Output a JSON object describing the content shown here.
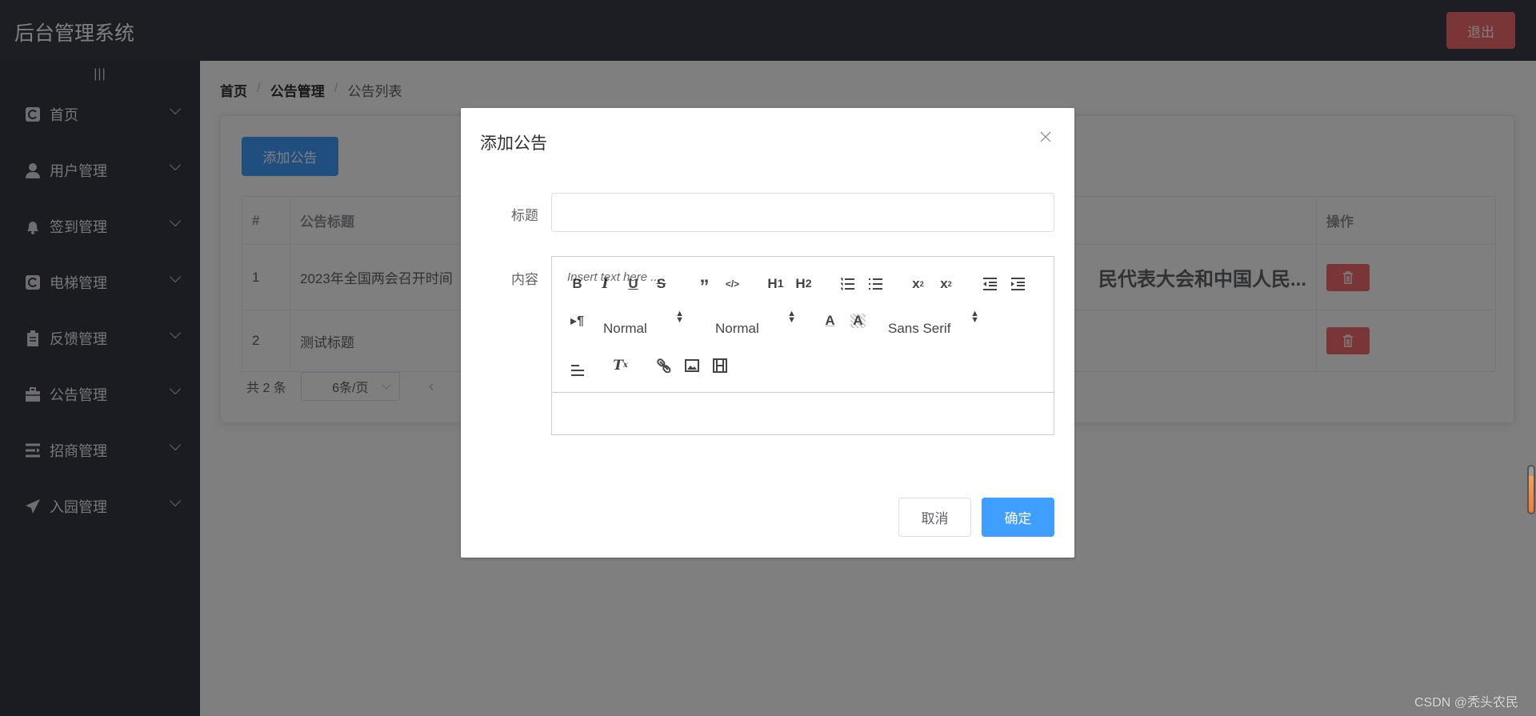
{
  "header": {
    "title": "后台管理系统",
    "logout_label": "退出"
  },
  "sidebar": {
    "toggle": "|||",
    "items": [
      {
        "label": "首页",
        "icon": "eleme-icon"
      },
      {
        "label": "用户管理",
        "icon": "user-icon"
      },
      {
        "label": "签到管理",
        "icon": "bell-icon"
      },
      {
        "label": "电梯管理",
        "icon": "eleme-icon"
      },
      {
        "label": "反馈管理",
        "icon": "clipboard-icon"
      },
      {
        "label": "公告管理",
        "icon": "briefcase-icon"
      },
      {
        "label": "招商管理",
        "icon": "menu-unfold-icon"
      },
      {
        "label": "入园管理",
        "icon": "paper-plane-icon"
      }
    ]
  },
  "breadcrumb": [
    "首页",
    "公告管理",
    "公告列表"
  ],
  "main": {
    "add_label": "添加公告",
    "table": {
      "headers": [
        "#",
        "公告标题",
        "操作"
      ],
      "rows": [
        {
          "index": "1",
          "title": "2023年全国两会召开时间",
          "content": "民代表大会和中国人民..."
        },
        {
          "index": "2",
          "title": "测试标题",
          "content": ""
        }
      ]
    },
    "pagination": {
      "total": "共 2 条",
      "page_size": "6条/页"
    }
  },
  "modal": {
    "title": "添加公告",
    "title_label": "标题",
    "title_value": "",
    "content_label": "内容",
    "editor": {
      "header_picker": "Normal",
      "size_picker": "Normal",
      "font_picker": "Sans Serif",
      "placeholder": "Insert text here ..."
    },
    "cancel_label": "取消",
    "confirm_label": "确定"
  },
  "watermark": "CSDN @秃头农民",
  "colors": {
    "primary": "#409eff",
    "danger": "#f56c6c",
    "header": "#393c47",
    "sidebar": "#373944"
  }
}
